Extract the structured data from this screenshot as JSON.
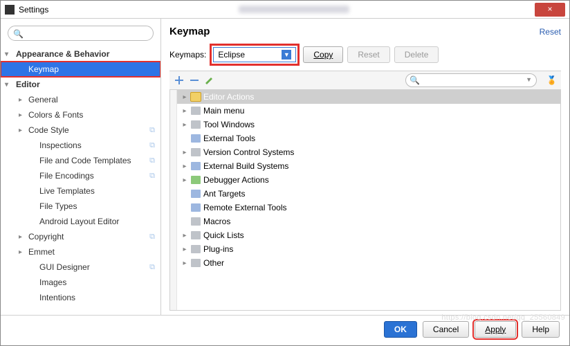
{
  "window": {
    "title": "Settings",
    "close": "×"
  },
  "sidebar": {
    "search_placeholder": "",
    "items": [
      {
        "label": "Appearance & Behavior",
        "level": 0,
        "arrow": "▾",
        "selected": false,
        "copy": false
      },
      {
        "label": "Keymap",
        "level": 1,
        "arrow": "",
        "selected": true,
        "copy": false,
        "highlight": true
      },
      {
        "label": "Editor",
        "level": 0,
        "arrow": "▾",
        "selected": false,
        "copy": false
      },
      {
        "label": "General",
        "level": 1,
        "arrow": "▸",
        "selected": false,
        "copy": false
      },
      {
        "label": "Colors & Fonts",
        "level": 1,
        "arrow": "▸",
        "selected": false,
        "copy": false
      },
      {
        "label": "Code Style",
        "level": 1,
        "arrow": "▸",
        "selected": false,
        "copy": true
      },
      {
        "label": "Inspections",
        "level": 2,
        "arrow": "",
        "selected": false,
        "copy": true
      },
      {
        "label": "File and Code Templates",
        "level": 2,
        "arrow": "",
        "selected": false,
        "copy": true
      },
      {
        "label": "File Encodings",
        "level": 2,
        "arrow": "",
        "selected": false,
        "copy": true
      },
      {
        "label": "Live Templates",
        "level": 2,
        "arrow": "",
        "selected": false,
        "copy": false
      },
      {
        "label": "File Types",
        "level": 2,
        "arrow": "",
        "selected": false,
        "copy": false
      },
      {
        "label": "Android Layout Editor",
        "level": 2,
        "arrow": "",
        "selected": false,
        "copy": false
      },
      {
        "label": "Copyright",
        "level": 1,
        "arrow": "▸",
        "selected": false,
        "copy": true
      },
      {
        "label": "Emmet",
        "level": 1,
        "arrow": "▸",
        "selected": false,
        "copy": false
      },
      {
        "label": "GUI Designer",
        "level": 2,
        "arrow": "",
        "selected": false,
        "copy": true
      },
      {
        "label": "Images",
        "level": 2,
        "arrow": "",
        "selected": false,
        "copy": false
      },
      {
        "label": "Intentions",
        "level": 2,
        "arrow": "",
        "selected": false,
        "copy": false
      }
    ]
  },
  "main": {
    "title": "Keymap",
    "reset": "Reset",
    "keymaps_label": "Keymaps:",
    "keymaps_value": "Eclipse",
    "copy_btn": "Copy",
    "reset_btn": "Reset",
    "delete_btn": "Delete",
    "search_placeholder": "",
    "tree": [
      {
        "label": "Editor Actions",
        "top": true,
        "arrow": "▸",
        "icon": "top"
      },
      {
        "label": "Main menu",
        "arrow": "▸",
        "icon": "folder"
      },
      {
        "label": "Tool Windows",
        "arrow": "▸",
        "icon": "folder"
      },
      {
        "label": "External Tools",
        "arrow": "",
        "icon": "tool"
      },
      {
        "label": "Version Control Systems",
        "arrow": "▸",
        "icon": "folder"
      },
      {
        "label": "External Build Systems",
        "arrow": "▸",
        "icon": "tool"
      },
      {
        "label": "Debugger Actions",
        "arrow": "▸",
        "icon": "bug"
      },
      {
        "label": "Ant Targets",
        "arrow": "",
        "icon": "tool"
      },
      {
        "label": "Remote External Tools",
        "arrow": "",
        "icon": "tool"
      },
      {
        "label": "Macros",
        "arrow": "",
        "icon": "folder"
      },
      {
        "label": "Quick Lists",
        "arrow": "▸",
        "icon": "folder"
      },
      {
        "label": "Plug-ins",
        "arrow": "▸",
        "icon": "folder"
      },
      {
        "label": "Other",
        "arrow": "▸",
        "icon": "folder"
      }
    ]
  },
  "footer": {
    "ok": "OK",
    "cancel": "Cancel",
    "apply": "Apply",
    "help": "Help"
  },
  "watermark": "https://blog.csdn.net/qq_25560849"
}
